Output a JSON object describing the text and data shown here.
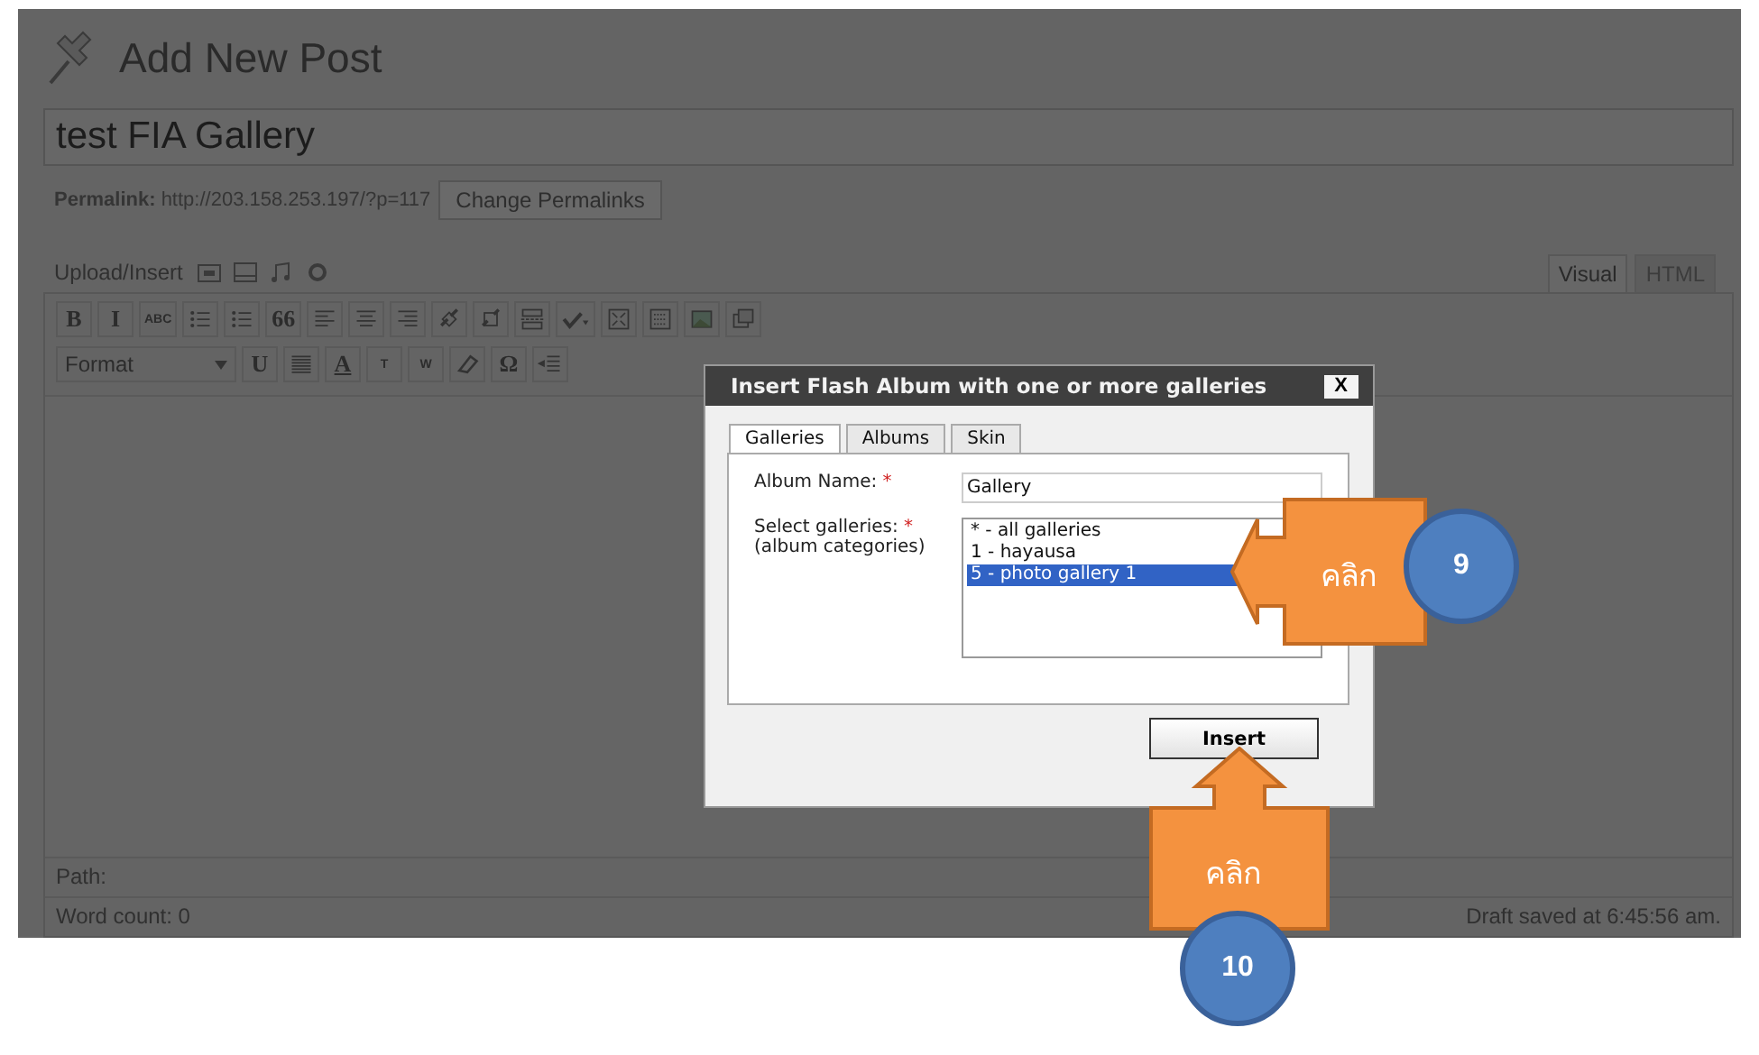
{
  "page": {
    "title": "Add New Post"
  },
  "post": {
    "title": "test FIA Gallery",
    "permalink_label": "Permalink:",
    "permalink": "http://203.158.253.197/?p=117",
    "change_button": "Change Permalinks"
  },
  "upload": {
    "label": "Upload/Insert",
    "media": [
      {
        "kind": "image"
      },
      {
        "kind": "video"
      },
      {
        "kind": "audio"
      },
      {
        "kind": "media"
      }
    ]
  },
  "editor_tabs": [
    {
      "label": "Visual",
      "selected": true
    },
    {
      "label": "HTML",
      "selected": false
    }
  ],
  "toolbar_1": [
    {
      "kind": "letter",
      "label": "B"
    },
    {
      "kind": "letter",
      "label": "I"
    },
    {
      "kind": "small",
      "label": "ABC"
    },
    {
      "kind": "bullets"
    },
    {
      "kind": "numbers"
    },
    {
      "kind": "letter",
      "label": "66"
    },
    {
      "kind": "align-left"
    },
    {
      "kind": "align-center"
    },
    {
      "kind": "align-right"
    },
    {
      "kind": "link"
    },
    {
      "kind": "unlink"
    },
    {
      "kind": "more"
    },
    {
      "kind": "spell"
    },
    {
      "kind": "fullscreen"
    },
    {
      "kind": "keyboard"
    },
    {
      "kind": "image"
    },
    {
      "kind": "gallery"
    }
  ],
  "toolbar_2": [
    {
      "kind": "select",
      "label": "Format"
    },
    {
      "kind": "letter",
      "label": "U"
    },
    {
      "kind": "justify"
    },
    {
      "kind": "color",
      "label": "A"
    },
    {
      "kind": "paste",
      "label": "T"
    },
    {
      "kind": "paste",
      "label": "W"
    },
    {
      "kind": "eraser"
    },
    {
      "kind": "letter",
      "label": "Ω"
    },
    {
      "kind": "outdent"
    }
  ],
  "path_label": "Path:",
  "word_count": "Word count: 0",
  "draft_status": "Draft saved at 6:45:56 am.",
  "dialog": {
    "title": "Insert Flash Album with one or more galleries",
    "close": "X",
    "tabs": [
      {
        "label": "Galleries",
        "selected": true
      },
      {
        "label": "Albums",
        "selected": false
      },
      {
        "label": "Skin",
        "selected": false
      }
    ],
    "album_name_label": "Album Name:",
    "required_mark": "*",
    "album_name": "Gallery",
    "galleries_label": "Select galleries:",
    "galleries_hint": "(album categories)",
    "galleries": [
      {
        "label": "* - all galleries",
        "selected": false
      },
      {
        "label": "1 - hayausa",
        "selected": false
      },
      {
        "label": "5 - photo gallery 1",
        "selected": true
      }
    ],
    "insert_button": "Insert"
  },
  "callouts": [
    {
      "label": "คลิก",
      "step": "9",
      "kind": "left"
    },
    {
      "label": "คลิก",
      "step": "10",
      "kind": "up"
    }
  ]
}
